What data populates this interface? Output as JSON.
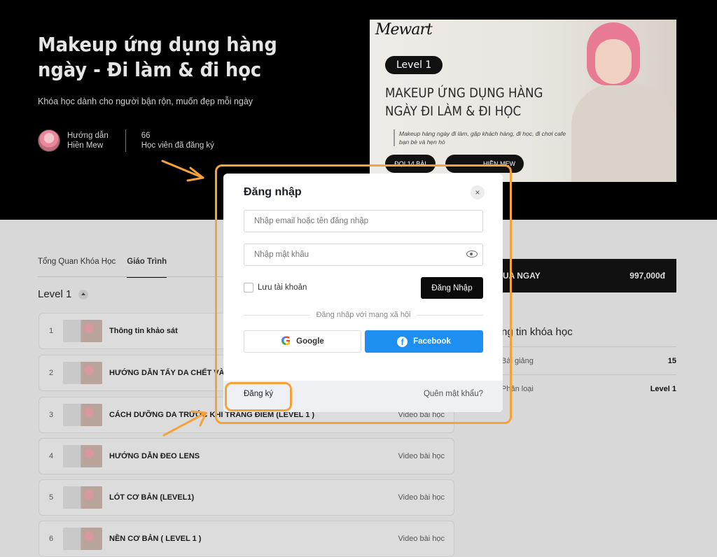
{
  "hero": {
    "title": "Makeup ứng dụng hàng ngày - Đi làm & đi học",
    "subtitle": "Khóa học dành cho người bận rộn, muốn đẹp mỗi ngày",
    "instructor_label": "Hướng dẫn",
    "instructor_name": "Hiền Mew",
    "students_count": "66",
    "students_label": "Học viên đã đăng ký"
  },
  "banner": {
    "brand": "Mewart",
    "level": "Level 1",
    "heading": "MAKEUP ỨNG DỤNG HÀNG NGÀY ĐI LÀM & ĐI HỌC",
    "desc": "Makeup hàng ngày đi làm, gặp khách hàng, đi học, đi chơi cafe bạn bè và hẹn hò",
    "btn1": "ĐỌI 14 BÀI",
    "btn2": "HIỀN MEW"
  },
  "tabs": [
    {
      "label": "Tổng Quan Khóa Học",
      "active": false
    },
    {
      "label": "Giáo Trình",
      "active": true
    }
  ],
  "level_title": "Level 1",
  "lessons": [
    {
      "num": "1",
      "title": "Thông tin khảo sát",
      "type": ""
    },
    {
      "num": "2",
      "title": "HƯỚNG DẪN TẨY DA CHẾT VÀ",
      "type": ""
    },
    {
      "num": "3",
      "title": "CÁCH DƯỠNG DA TRƯỚC KHI TRANG ĐIỂM (LEVEL 1 )",
      "type": "Video bài học"
    },
    {
      "num": "4",
      "title": "HƯỚNG DẪN ĐEO LENS",
      "type": "Video bài học"
    },
    {
      "num": "5",
      "title": "LÓT CƠ BẢN (LEVEL1)",
      "type": "Video bài học"
    },
    {
      "num": "6",
      "title": "NỀN CƠ BẢN ( LEVEL 1 )",
      "type": "Video bài học"
    }
  ],
  "sidebar": {
    "buy_label": "UA NGAY",
    "price": "997,000đ",
    "info_title": "ng tin khóa học",
    "rows": [
      {
        "label": "Bài giảng",
        "value": "15"
      },
      {
        "label": "Phân loại",
        "value": "Level 1"
      }
    ]
  },
  "modal": {
    "title": "Đăng nhập",
    "close": "×",
    "email_placeholder": "Nhập email hoặc tên đăng nhập",
    "password_placeholder": "Nhập mật khẩu",
    "remember": "Lưu tài khoản",
    "login_button": "Đăng Nhập",
    "divider": "Đăng nhập với mạng xã hội",
    "google": "Google",
    "facebook": "Facebook",
    "register": "Đăng ký",
    "forgot": "Quên mật khẩu?"
  },
  "colors": {
    "annotation": "#f5a23a",
    "facebook": "#1f8ef1",
    "hero_bg": "#000000"
  }
}
